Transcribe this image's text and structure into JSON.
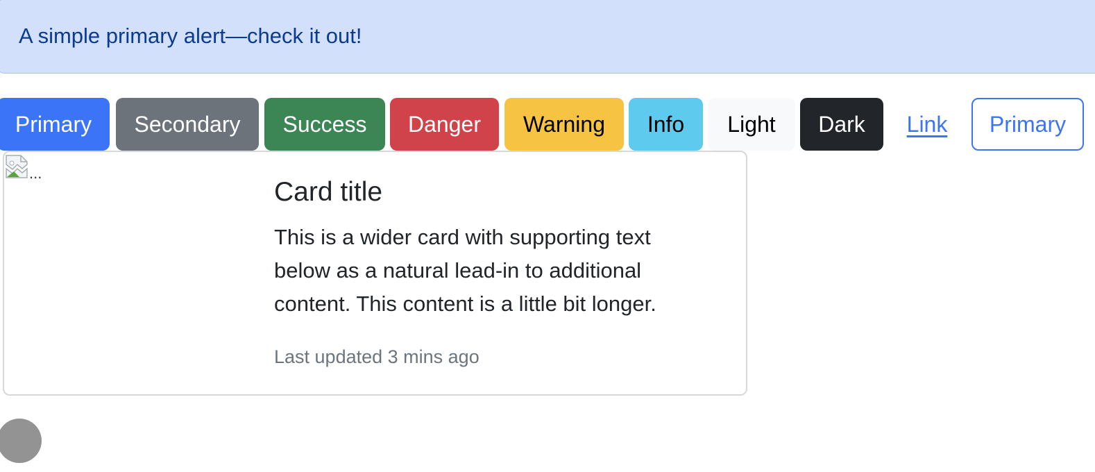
{
  "alert": {
    "text": "A simple primary alert—check it out!"
  },
  "buttons": {
    "primary": "Primary",
    "secondary": "Secondary",
    "success": "Success",
    "danger": "Danger",
    "warning": "Warning",
    "info": "Info",
    "light": "Light",
    "dark": "Dark",
    "link": "Link",
    "outline_primary": "Primary"
  },
  "card": {
    "image_alt": "...",
    "image_icon": "broken-image-icon",
    "title": "Card title",
    "text": "This is a wider card with supporting text below as a natural lead-in to additional content. This content is a little bit longer.",
    "muted": "Last updated 3 mins ago"
  },
  "colors": {
    "primary": "#3b74f6",
    "secondary": "#6c737b",
    "success": "#3c8656",
    "danger": "#d1434a",
    "warning": "#f6c342",
    "info": "#5ecaed",
    "light": "#f8f9fa",
    "dark": "#22252a",
    "alert_bg": "#d3e0fb"
  }
}
